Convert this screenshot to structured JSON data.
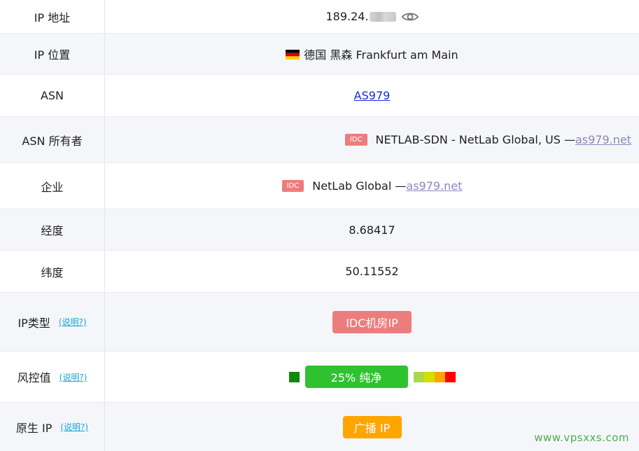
{
  "rows": {
    "ip_address": {
      "label": "IP 地址",
      "value": "189.24."
    },
    "ip_location": {
      "label": "IP 位置",
      "value": "德国 黑森 Frankfurt am Main"
    },
    "asn": {
      "label": "ASN",
      "value": "AS979"
    },
    "asn_owner": {
      "label": "ASN 所有者",
      "badge": "IDC",
      "value": "NETLAB-SDN - NetLab Global, US —",
      "link": "as979.net"
    },
    "enterprise": {
      "label": "企业",
      "badge": "IDC",
      "value": "NetLab Global —",
      "link": "as979.net"
    },
    "longitude": {
      "label": "经度",
      "value": "8.68417"
    },
    "latitude": {
      "label": "纬度",
      "value": "50.11552"
    },
    "ip_type": {
      "label": "IP类型",
      "help": "(说明?)",
      "value": "IDC机房IP"
    },
    "risk": {
      "label": "风控值",
      "help": "(说明?)",
      "value": "25%   纯净",
      "score_fraction": 0.25
    },
    "native_ip": {
      "label": "原生 IP",
      "help": "(说明?)",
      "value": "广播 IP"
    }
  },
  "colors": {
    "badge_red": "#ec7d7d",
    "risk_green": "#2fc22f",
    "risk_dark_green": "#0b8a0b",
    "broadcast_orange": "#ffa500",
    "risk_scale": [
      "#a8d948",
      "#d4de00",
      "#ffa500",
      "#ff0000"
    ]
  },
  "icons": {
    "eye": "eye-icon",
    "flag": "germany-flag-icon"
  },
  "watermark": "www.vpsxxs.com"
}
